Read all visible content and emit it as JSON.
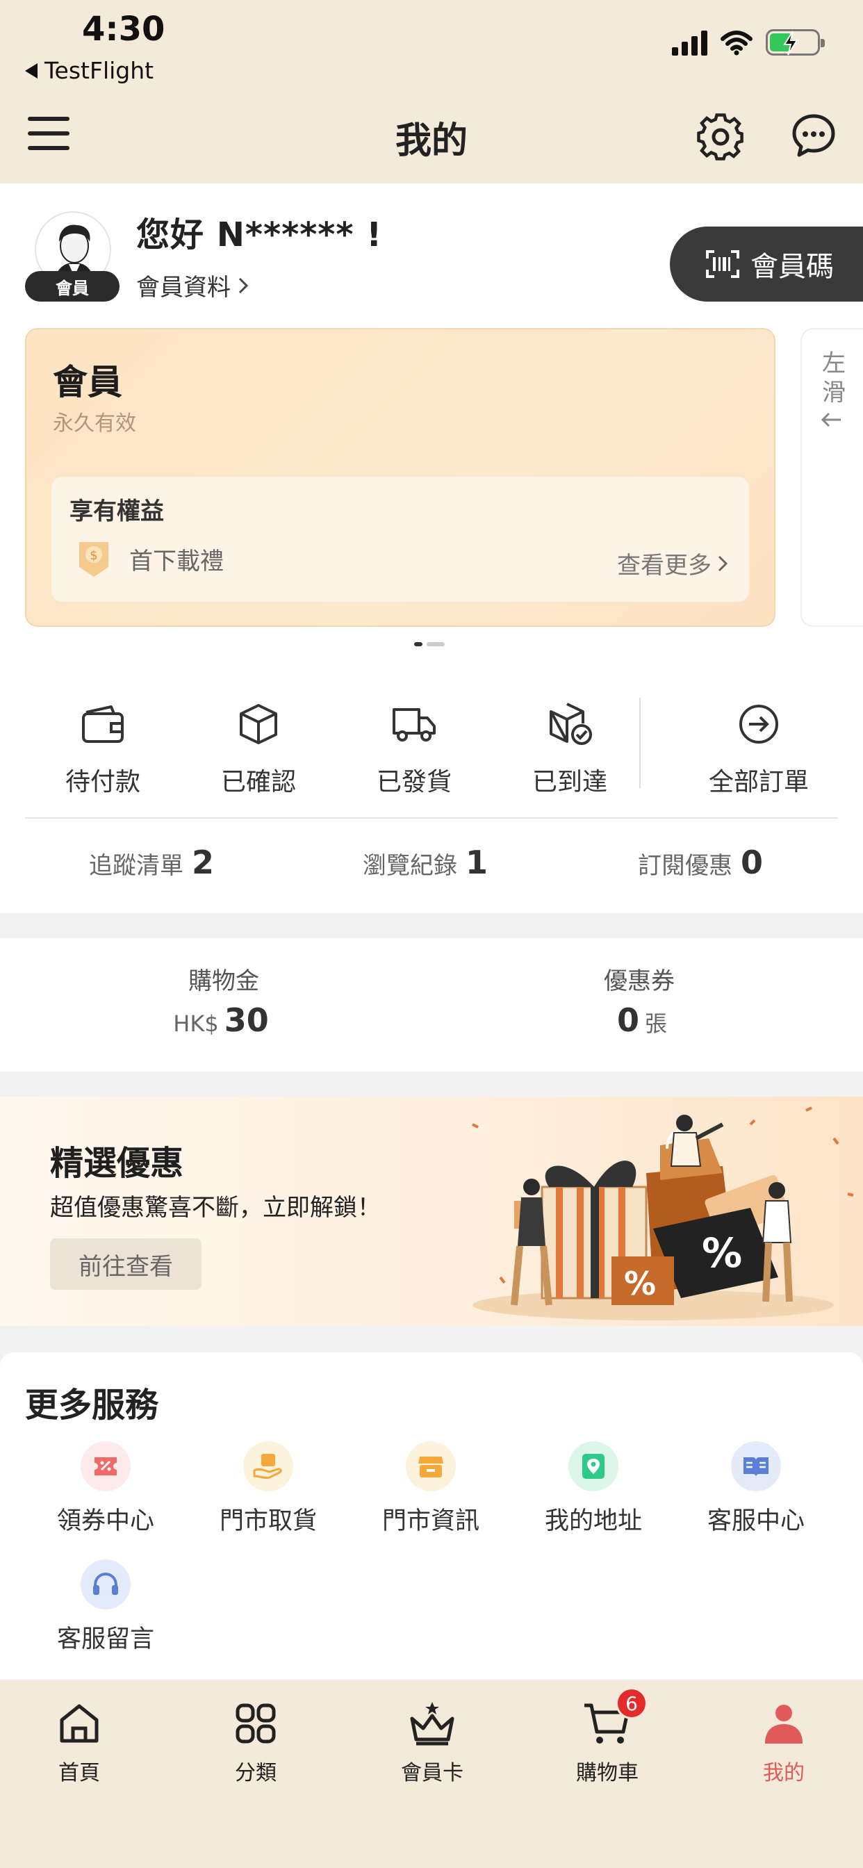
{
  "status_bar": {
    "time": "4:30",
    "back_app": "TestFlight"
  },
  "header": {
    "title": "我的",
    "icons": [
      "menu-icon",
      "gear-icon",
      "chat-icon"
    ]
  },
  "profile": {
    "avatar_badge": "會員",
    "greeting": "您好 N****** !",
    "member_info_link": "會員資料",
    "member_code_button": "會員碼"
  },
  "membership_card": {
    "tier": "會員",
    "validity": "永久有效",
    "benefits_title": "享有權益",
    "benefit_item": "首下載禮",
    "more_link": "查看更多",
    "next_card_hint": "左滑"
  },
  "orders": [
    {
      "label": "待付款",
      "icon": "wallet-icon"
    },
    {
      "label": "已確認",
      "icon": "box-icon"
    },
    {
      "label": "已發貨",
      "icon": "truck-icon"
    },
    {
      "label": "已到達",
      "icon": "box-check-icon"
    },
    {
      "label": "全部訂單",
      "icon": "arrow-circle-icon"
    }
  ],
  "stats": [
    {
      "label": "追蹤清單",
      "value": "2"
    },
    {
      "label": "瀏覽紀錄",
      "value": "1"
    },
    {
      "label": "訂閱優惠",
      "value": "0"
    }
  ],
  "wallet": {
    "credit": {
      "label": "購物金",
      "prefix": "HK$",
      "value": "30"
    },
    "coupons": {
      "label": "優惠券",
      "value": "0",
      "unit": "張"
    }
  },
  "promo": {
    "title": "精選優惠",
    "subtitle": "超值優惠驚喜不斷，立即解鎖！",
    "button": "前往查看"
  },
  "services": {
    "title": "更多服務",
    "items": [
      {
        "label": "領券中心",
        "icon": "coupon-icon",
        "color": "#f06a6a"
      },
      {
        "label": "門市取貨",
        "icon": "pickup-icon",
        "color": "#f3a93a"
      },
      {
        "label": "門市資訊",
        "icon": "store-icon",
        "color": "#f3a93a"
      },
      {
        "label": "我的地址",
        "icon": "address-icon",
        "color": "#2fc98a"
      },
      {
        "label": "客服中心",
        "icon": "help-book-icon",
        "color": "#5b7fd6"
      },
      {
        "label": "客服留言",
        "icon": "headset-icon",
        "color": "#5b7fd6"
      }
    ]
  },
  "tabbar": {
    "items": [
      {
        "label": "首頁",
        "icon": "home-icon"
      },
      {
        "label": "分類",
        "icon": "category-icon"
      },
      {
        "label": "會員卡",
        "icon": "crown-icon"
      },
      {
        "label": "購物車",
        "icon": "cart-icon",
        "badge": "6"
      },
      {
        "label": "我的",
        "icon": "user-icon",
        "active": true
      }
    ],
    "active_color": "#e05a5a"
  }
}
